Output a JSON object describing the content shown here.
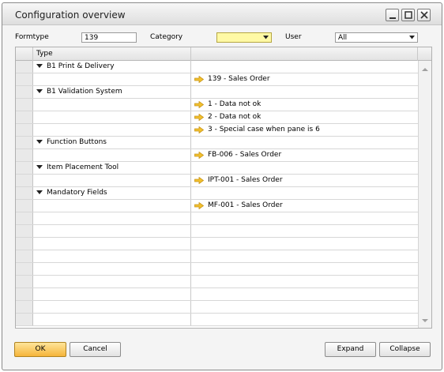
{
  "window": {
    "title": "Configuration overview"
  },
  "filters": {
    "formtype_label": "Formtype",
    "formtype_value": "139",
    "category_label": "Category",
    "category_value": "",
    "user_label": "User",
    "user_value": "All"
  },
  "grid": {
    "columns": [
      "Type",
      ""
    ],
    "rows": [
      {
        "kind": "group",
        "label": "B1 Print & Delivery"
      },
      {
        "kind": "item",
        "label": "139 - Sales Order"
      },
      {
        "kind": "group",
        "label": "B1 Validation System"
      },
      {
        "kind": "item",
        "label": "1 - Data not ok"
      },
      {
        "kind": "item",
        "label": "2 - Data not ok"
      },
      {
        "kind": "item",
        "label": "3 - Special case when pane is 6"
      },
      {
        "kind": "group",
        "label": "Function Buttons"
      },
      {
        "kind": "item",
        "label": "FB-006 - Sales Order"
      },
      {
        "kind": "group",
        "label": "Item Placement Tool"
      },
      {
        "kind": "item",
        "label": "IPT-001 - Sales Order"
      },
      {
        "kind": "group",
        "label": "Mandatory Fields"
      },
      {
        "kind": "item",
        "label": "MF-001 - Sales Order"
      }
    ]
  },
  "buttons": {
    "ok": "OK",
    "cancel": "Cancel",
    "expand": "Expand",
    "collapse": "Collapse"
  },
  "colors": {
    "accent_orange": "#f5b43a",
    "highlight_yellow": "#fff9a5",
    "arrow_yellow": "#f2c12e"
  }
}
